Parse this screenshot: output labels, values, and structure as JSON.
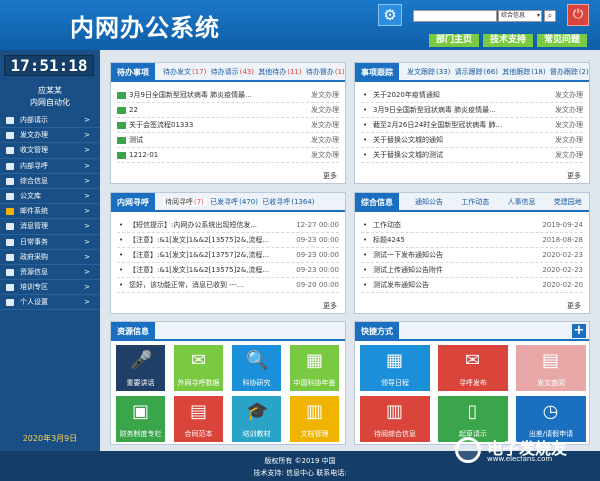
{
  "header": {
    "title": "内网办公系统",
    "search_placeholder": "",
    "search_select": "综合信息",
    "links": [
      "部门主页",
      "技术支持",
      "常见问题"
    ]
  },
  "sidebar": {
    "clock": "17:51:18",
    "user_name": "应某某",
    "user_org": "内网自动化",
    "menu": [
      {
        "label": "内部请示",
        "arrow": ">"
      },
      {
        "label": "发文办理",
        "arrow": ">"
      },
      {
        "label": "收文管理",
        "arrow": ">"
      },
      {
        "label": "内部寻呼",
        "arrow": ">"
      },
      {
        "label": "综合信息",
        "arrow": ">"
      },
      {
        "label": "公文库",
        "arrow": ">"
      },
      {
        "label": "邮件系统",
        "arrow": ">"
      },
      {
        "label": "消息管理",
        "arrow": ">"
      },
      {
        "label": "日常事务",
        "arrow": ">"
      },
      {
        "label": "政府采购",
        "arrow": ">"
      },
      {
        "label": "资源信息",
        "arrow": ">"
      },
      {
        "label": "培训专区",
        "arrow": ">"
      },
      {
        "label": "个人设置",
        "arrow": ">"
      }
    ],
    "date": "2020年3月9日"
  },
  "todo": {
    "title": "待办事项",
    "tabs": [
      {
        "label": "待办发文",
        "count": "(17)"
      },
      {
        "label": "待办请示",
        "count": "(43)"
      },
      {
        "label": "其他待办",
        "count": "(11)"
      },
      {
        "label": "待办督办",
        "count": "(1)"
      }
    ],
    "rows": [
      {
        "text": "3月9日全国新型冠状病毒 肺炎疫情最...",
        "right": "发文办理"
      },
      {
        "text": "22",
        "right": "发文办理"
      },
      {
        "text": "关于会签流程01333",
        "right": "发文办理"
      },
      {
        "text": "测试",
        "right": "发文办理"
      },
      {
        "text": "1212-01",
        "right": "发文办理"
      }
    ],
    "more": "更多"
  },
  "track": {
    "title": "事项跟踪",
    "tabs": [
      {
        "label": "发文跟踪",
        "count": "(33)"
      },
      {
        "label": "请示跟踪",
        "count": "(66)"
      },
      {
        "label": "其他跟踪",
        "count": "(18)"
      },
      {
        "label": "督办跟踪",
        "count": "(2)"
      }
    ],
    "rows": [
      {
        "text": "关于2020年疫情通知",
        "right": "发文办理"
      },
      {
        "text": "3月9日全国新型冠状病毒 肺炎疫情最...",
        "right": "发文办理"
      },
      {
        "text": "截至2月26日24时全国新型冠状病毒 肺...",
        "right": "发文办理"
      },
      {
        "text": "关于替换公文城的通知",
        "right": "发文办理"
      },
      {
        "text": "关于替换公文城的测试",
        "right": "发文办理"
      }
    ],
    "more": "更多"
  },
  "pager": {
    "title": "内网寻呼",
    "tabs": [
      {
        "label": "待阅寻呼",
        "count": "(7)"
      },
      {
        "label": "已发寻呼",
        "count": "(470)"
      },
      {
        "label": "已收寻呼",
        "count": "(1364)"
      }
    ],
    "rows": [
      {
        "text": "【短信提示】:内网办公系统出现短信发...",
        "right": "12-27 00:00"
      },
      {
        "text": "【注意】:&1[发文]1&&2[13575]2&,流程...",
        "right": "09-23 00:00"
      },
      {
        "text": "【注意】:&1[发文]1&&2[13757]2&,流程...",
        "right": "09-23 00:00"
      },
      {
        "text": "【注意】:&1[发文]1&&2[13575]2&,流程...",
        "right": "09-23 00:00"
      },
      {
        "text": "您好，该功能正常，消息已收到 ---...",
        "right": "09-20 00:00"
      }
    ],
    "more": "更多"
  },
  "info": {
    "title": "综合信息",
    "tabs": [
      "通知公告",
      "工作动态",
      "人事信息",
      "党建园地"
    ],
    "rows": [
      {
        "text": "工作动态",
        "right": "2019-09-24"
      },
      {
        "text": "标题4245",
        "right": "2018-08-28"
      },
      {
        "text": "测试一下发布通知公告",
        "right": "2020-02-23"
      },
      {
        "text": "测试上传通知公告附件",
        "right": "2020-02-23"
      },
      {
        "text": "测试发布通知公告",
        "right": "2020-02-20"
      }
    ],
    "more": "更多"
  },
  "resources": {
    "title": "资源信息",
    "tiles": [
      {
        "label": "重要讲话",
        "icon": "microphone-icon",
        "glyph": "🎤",
        "color": "#1f3f66"
      },
      {
        "label": "外网寻呼数据",
        "icon": "envelope-icon",
        "glyph": "✉",
        "color": "#7ac943"
      },
      {
        "label": "科协研究",
        "icon": "magnifier-icon",
        "glyph": "🔍",
        "color": "#1b8fd9"
      },
      {
        "label": "中国科协年鉴",
        "icon": "map-icon",
        "glyph": "▦",
        "color": "#7ac943"
      },
      {
        "label": "财务制度专栏",
        "icon": "briefcase-icon",
        "glyph": "▣",
        "color": "#3aa54a"
      },
      {
        "label": "合同范本",
        "icon": "contract-icon",
        "glyph": "▤",
        "color": "#d9443b"
      },
      {
        "label": "培训教材",
        "icon": "graduation-cap-icon",
        "glyph": "🎓",
        "color": "#2aa3c9"
      },
      {
        "label": "文档管理",
        "icon": "books-icon",
        "glyph": "▥",
        "color": "#f0b400"
      }
    ]
  },
  "shortcuts": {
    "title": "快捷方式",
    "add": "+",
    "tiles": [
      {
        "label": "领导日程",
        "icon": "calendar-icon",
        "glyph": "▦",
        "color": "#1b8fd9"
      },
      {
        "label": "寻呼发布",
        "icon": "envelope-icon",
        "glyph": "✉",
        "color": "#d9443b"
      },
      {
        "label": "发文查阅",
        "icon": "document-search-icon",
        "glyph": "▤",
        "color": "#e8a8a8"
      },
      {
        "label": "待阅综合信息",
        "icon": "document-icon",
        "glyph": "▥",
        "color": "#d9443b"
      },
      {
        "label": "起草请示",
        "icon": "book-icon",
        "glyph": "▯",
        "color": "#3aa54a"
      },
      {
        "label": "出差/请假申请",
        "icon": "clock-icon",
        "glyph": "◷",
        "color": "#1a6fc0"
      }
    ]
  },
  "footer": {
    "line1": "版权所有  ©2019  中国",
    "line2": "技术支持: 信息中心  联系电话:"
  },
  "watermark": {
    "line1": "电子发烧友",
    "line2": "www.elecfans.com"
  }
}
